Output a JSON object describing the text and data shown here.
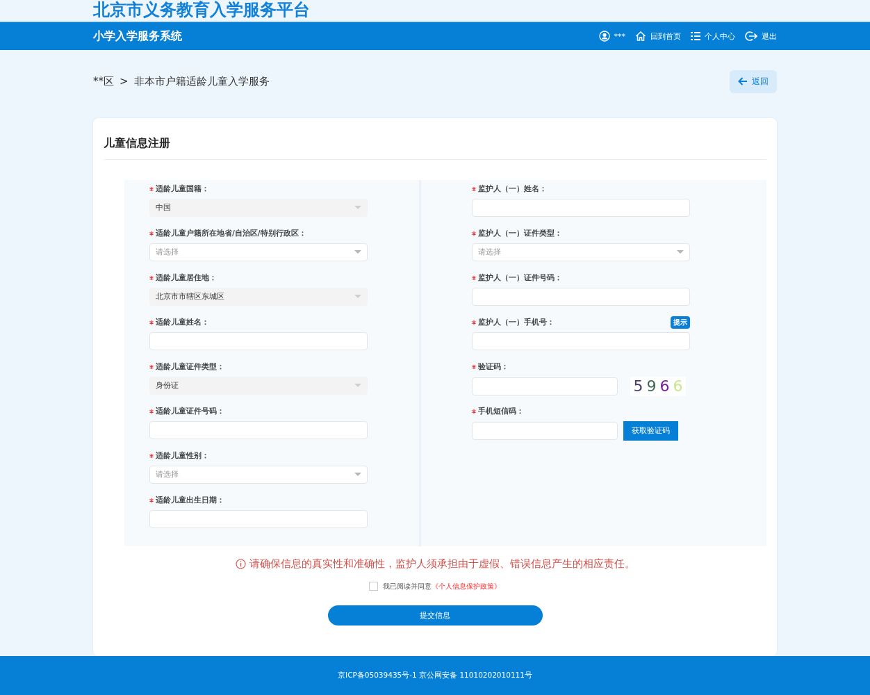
{
  "header": {
    "title": "北京市义务教育入学服务平台",
    "subtitle": "小学入学服务系统",
    "nav": [
      {
        "kind": "user",
        "label": "***"
      },
      {
        "kind": "home",
        "label": "回到首页"
      },
      {
        "kind": "list",
        "label": "个人中心"
      },
      {
        "kind": "logout",
        "label": "退出"
      }
    ]
  },
  "breadcrumb": {
    "items": [
      "**区",
      "非本市户籍适龄儿童入学服务"
    ],
    "separator": ">"
  },
  "back_button": "返回",
  "form": {
    "title": "儿童信息注册",
    "columns": [
      [
        {
          "kind": "select",
          "label": "适龄儿童国籍：",
          "required": true,
          "value": "中国",
          "disabled": true
        },
        {
          "kind": "select",
          "label": "适龄儿童户籍所在地省/自治区/特别行政区：",
          "required": true,
          "placeholder": "请选择",
          "disabled": false
        },
        {
          "kind": "select",
          "label": "适龄儿童居住地：",
          "required": true,
          "value": "北京市市辖区东城区",
          "disabled": true
        },
        {
          "kind": "input",
          "label": "适龄儿童姓名：",
          "required": true
        },
        {
          "kind": "select",
          "label": "适龄儿童证件类型：",
          "required": true,
          "value": "身份证",
          "disabled": true
        },
        {
          "kind": "input",
          "label": "适龄儿童证件号码：",
          "required": true
        },
        {
          "kind": "select",
          "label": "适龄儿童性别：",
          "required": true,
          "placeholder": "请选择",
          "disabled": false
        },
        {
          "kind": "input",
          "label": "适龄儿童出生日期：",
          "required": true
        }
      ],
      [
        {
          "kind": "input",
          "label": "监护人（一）姓名：",
          "required": true
        },
        {
          "kind": "select",
          "label": "监护人（一）证件类型：",
          "required": true,
          "placeholder": "请选择",
          "disabled": false
        },
        {
          "kind": "input",
          "label": "监护人（一）证件号码：",
          "required": true
        },
        {
          "kind": "input",
          "label": "监护人（一）手机号：",
          "required": true,
          "badge": "提示"
        },
        {
          "kind": "captcha",
          "label": "验证码：",
          "required": true,
          "captcha": "5966"
        },
        {
          "kind": "sms",
          "label": "手机短信码：",
          "required": true,
          "button": "获取验证码"
        }
      ]
    ]
  },
  "notice": "请确保信息的真实性和准确性，监护人须承担由于虚假、错误信息产生的相应责任。",
  "agreement": {
    "checked": false,
    "text": "我已阅读并同意",
    "link": "《个人信息保护政策》"
  },
  "submit_button": "提交信息",
  "footer": "京ICP备05039435号-1 京公网安备 11010202010111号"
}
